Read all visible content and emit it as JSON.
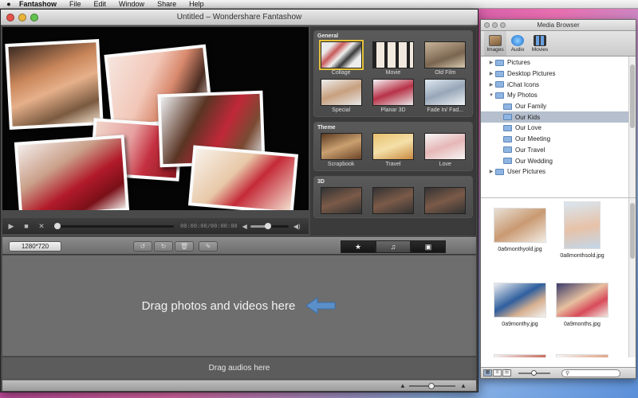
{
  "menubar": {
    "apple": "",
    "items": [
      "Fantashow",
      "File",
      "Edit",
      "Window",
      "Share",
      "Help"
    ]
  },
  "window": {
    "title": "Untitled – Wondershare Fantashow"
  },
  "playback": {
    "timecode": "00:00:00/00:00:00",
    "progress": 0,
    "volume": 0.45
  },
  "effects": {
    "groups": [
      {
        "title": "General",
        "items": [
          "Collage",
          "Movie",
          "Old Film",
          "Special",
          "Planar 3D",
          "Fade In/ Fad..."
        ]
      },
      {
        "title": "Theme",
        "items": [
          "Scrapbook",
          "Travel",
          "Love"
        ]
      },
      {
        "title": "3D",
        "items": [
          "",
          "",
          ""
        ]
      }
    ],
    "selected": "Collage"
  },
  "toolbar": {
    "resolution": "1280*720"
  },
  "dropzone": {
    "text": "Drag photos and videos here",
    "audio_text": "Drag audios here"
  },
  "media_browser": {
    "title": "Media Browser",
    "tabs": [
      "Images",
      "Audio",
      "Movies"
    ],
    "selected_tab": "Images",
    "tree": [
      {
        "label": "Pictures",
        "level": 1,
        "expanded": false
      },
      {
        "label": "Desktop Pictures",
        "level": 1,
        "expanded": false
      },
      {
        "label": "iChat Icons",
        "level": 1,
        "expanded": false
      },
      {
        "label": "My Photos",
        "level": 1,
        "expanded": true
      },
      {
        "label": "Our Family",
        "level": 2,
        "expanded": false
      },
      {
        "label": "Our Kids",
        "level": 2,
        "expanded": false,
        "selected": true
      },
      {
        "label": "Our Love",
        "level": 2,
        "expanded": false
      },
      {
        "label": "Our Meeting",
        "level": 2,
        "expanded": false
      },
      {
        "label": "Our Travel",
        "level": 2,
        "expanded": false
      },
      {
        "label": "Our Wedding",
        "level": 2,
        "expanded": false
      },
      {
        "label": "User Pictures",
        "level": 1,
        "expanded": false
      }
    ],
    "thumbnails": [
      {
        "name": "0a6monthyold.jpg"
      },
      {
        "name": "0a8monthsold.jpg"
      },
      {
        "name": "0a9monthy.jpg"
      },
      {
        "name": "0a9months.jpg"
      },
      {
        "name": ""
      },
      {
        "name": ""
      }
    ]
  },
  "colors": {
    "selection_highlight": "#e4c23a",
    "drop_arrow": "#5b8fc9"
  }
}
